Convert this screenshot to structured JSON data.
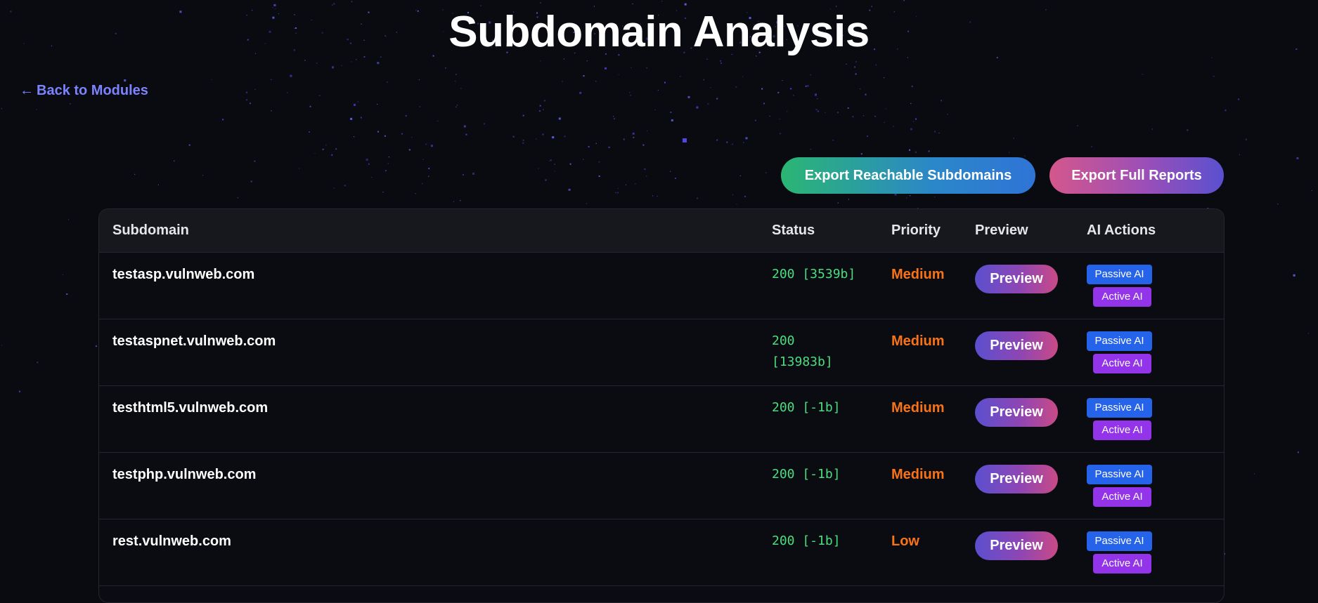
{
  "page": {
    "title": "Subdomain Analysis",
    "back_link": "Back to Modules",
    "back_arrow": "←"
  },
  "toolbar": {
    "export_reachable_label": "Export Reachable Subdomains",
    "export_full_label": "Export Full Reports"
  },
  "table": {
    "headers": {
      "subdomain": "Subdomain",
      "status": "Status",
      "priority": "Priority",
      "preview": "Preview",
      "ai_actions": "AI Actions"
    },
    "rows": [
      {
        "subdomain": "testasp.vulnweb.com",
        "status": "200 [3539b]",
        "priority": "Medium",
        "preview": "Preview",
        "passive": "Passive AI",
        "active": "Active AI"
      },
      {
        "subdomain": "testaspnet.vulnweb.com",
        "status": "200 [13983b]",
        "priority": "Medium",
        "preview": "Preview",
        "passive": "Passive AI",
        "active": "Active AI"
      },
      {
        "subdomain": "testhtml5.vulnweb.com",
        "status": "200 [-1b]",
        "priority": "Medium",
        "preview": "Preview",
        "passive": "Passive AI",
        "active": "Active AI"
      },
      {
        "subdomain": "testphp.vulnweb.com",
        "status": "200 [-1b]",
        "priority": "Medium",
        "preview": "Preview",
        "passive": "Passive AI",
        "active": "Active AI"
      },
      {
        "subdomain": "rest.vulnweb.com",
        "status": "200 [-1b]",
        "priority": "Low",
        "preview": "Preview",
        "passive": "Passive AI",
        "active": "Active AI"
      }
    ]
  },
  "colors": {
    "background": "#0a0b10",
    "accent_link": "#7c83ff",
    "status_green": "#4ade80",
    "priority_orange": "#f97316",
    "passive_blue": "#2563eb",
    "active_purple": "#9333ea"
  }
}
